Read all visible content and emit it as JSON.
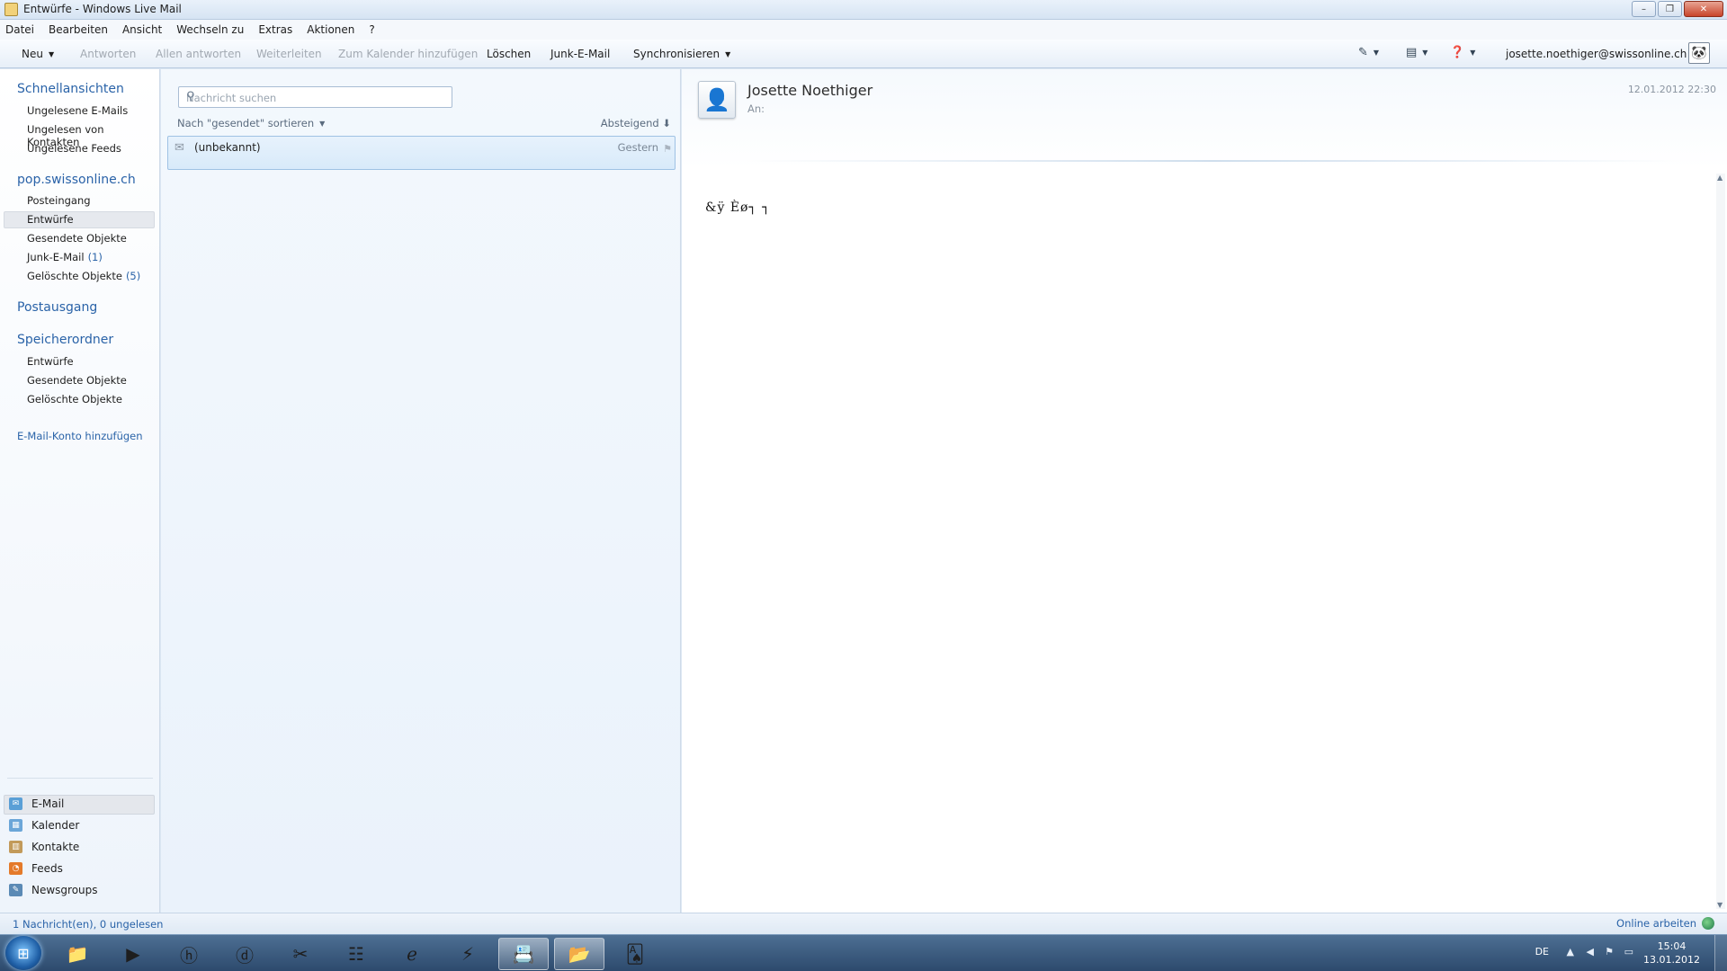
{
  "window": {
    "title": "Entwürfe - Windows Live Mail",
    "minimize_glyph": "–",
    "restore_glyph": "❐",
    "close_glyph": "✕"
  },
  "menu": [
    "Datei",
    "Bearbeiten",
    "Ansicht",
    "Wechseln zu",
    "Extras",
    "Aktionen",
    "?"
  ],
  "toolbar": {
    "new": "Neu",
    "reply": "Antworten",
    "reply_all": "Allen antworten",
    "forward": "Weiterleiten",
    "add_calendar": "Zum Kalender hinzufügen",
    "delete": "Löschen",
    "junk": "Junk-E-Mail",
    "sync": "Synchronisieren",
    "account": "josette.noethiger@swissonline.ch",
    "icons": [
      "paint-brush-icon",
      "layout-icon",
      "help-icon"
    ]
  },
  "folders": {
    "quick_views_title": "Schnellansichten",
    "quick_views": [
      "Ungelesene E-Mails",
      "Ungelesen von Kontakten",
      "Ungelesene Feeds"
    ],
    "account_title": "pop.swissonline.ch",
    "account_folders": [
      {
        "label": "Posteingang",
        "count": ""
      },
      {
        "label": "Entwürfe",
        "count": ""
      },
      {
        "label": "Gesendete Objekte",
        "count": ""
      },
      {
        "label": "Junk-E-Mail",
        "count": "(1)"
      },
      {
        "label": "Gelöschte Objekte",
        "count": "(5)"
      }
    ],
    "outbox_title": "Postausgang",
    "storage_title": "Speicherordner",
    "storage_folders": [
      "Entwürfe",
      "Gesendete Objekte",
      "Gelöschte Objekte"
    ],
    "add_account": "E-Mail-Konto hinzufügen"
  },
  "nav": [
    "E-Mail",
    "Kalender",
    "Kontakte",
    "Feeds",
    "Newsgroups"
  ],
  "list": {
    "search_placeholder": "Nachricht suchen",
    "sort_by": "Nach \"gesendet\" sortieren",
    "sort_dir": "Absteigend",
    "messages": [
      {
        "from": "(unbekannt)",
        "date": "Gestern"
      }
    ]
  },
  "reading": {
    "sender": "Josette Noethiger",
    "to_label": "An:",
    "date": "12.01.2012 22:30",
    "body": "&ÿ  Èø┐ ┐"
  },
  "status": {
    "left": "1 Nachricht(en), 0 ungelesen",
    "right": "Online arbeiten"
  },
  "taskbar": {
    "lang": "DE",
    "time": "15:04",
    "date": "13.01.2012",
    "apps": [
      "explorer-icon",
      "media-player-icon",
      "hp-icon",
      "dreamweaver-icon",
      "snipping-tool-icon",
      "network-icon",
      "internet-explorer-icon",
      "winamp-icon",
      "contacts-icon",
      "mail-icon",
      "solitaire-icon"
    ]
  },
  "colors": {
    "accent": "#2a63a8",
    "selection": "#d8eafa",
    "taskbar": "#2d4a6d"
  }
}
